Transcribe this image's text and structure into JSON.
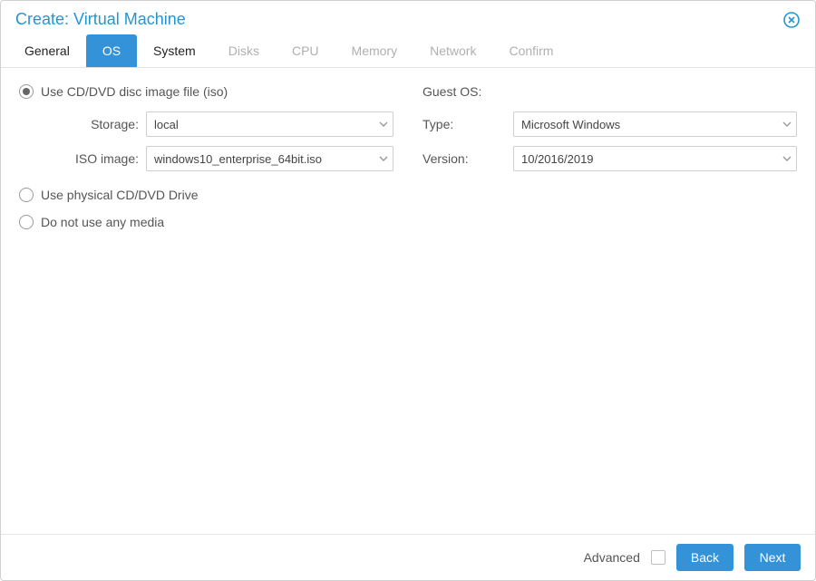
{
  "title": "Create: Virtual Machine",
  "tabs": {
    "general": "General",
    "os": "OS",
    "system": "System",
    "disks": "Disks",
    "cpu": "CPU",
    "memory": "Memory",
    "network": "Network",
    "confirm": "Confirm"
  },
  "left": {
    "radio_iso": "Use CD/DVD disc image file (iso)",
    "radio_physical": "Use physical CD/DVD Drive",
    "radio_none": "Do not use any media",
    "storage_label": "Storage:",
    "storage_value": "local",
    "iso_label": "ISO image:",
    "iso_value": "windows10_enterprise_64bit.iso"
  },
  "right": {
    "heading": "Guest OS:",
    "type_label": "Type:",
    "type_value": "Microsoft Windows",
    "version_label": "Version:",
    "version_value": "10/2016/2019"
  },
  "footer": {
    "advanced": "Advanced",
    "back": "Back",
    "next": "Next"
  }
}
